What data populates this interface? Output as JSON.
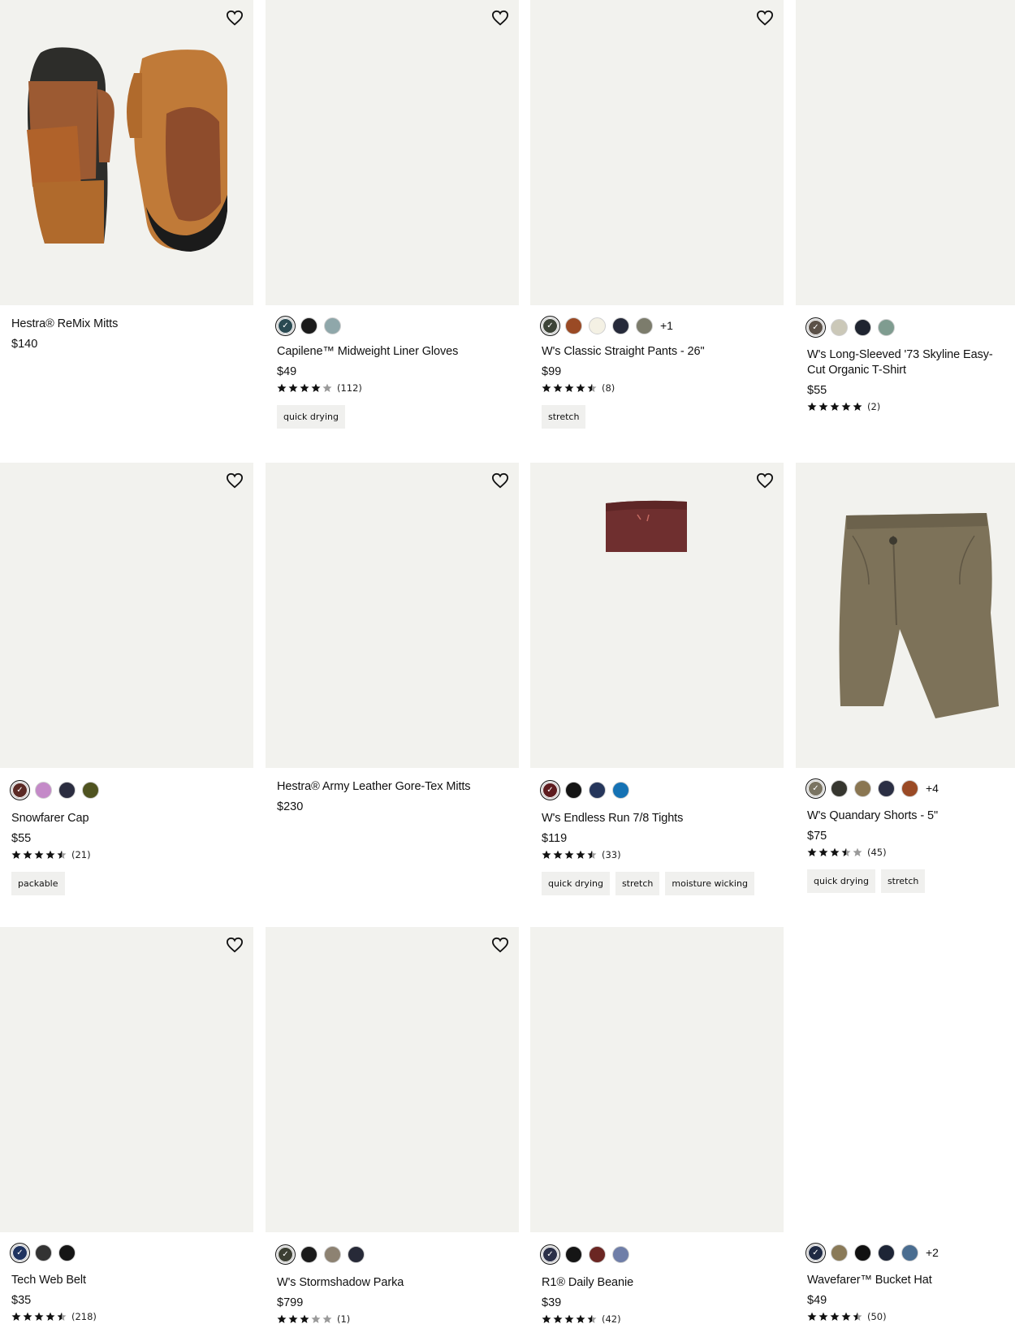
{
  "products": [
    {
      "name": "Hestra® ReMix Mitts",
      "price": "$140",
      "favorite_label": "Add to favorites"
    },
    {
      "name": "Capilene™ Midweight Liner Gloves",
      "price": "$49",
      "rating_count": "(112)",
      "rating": 4,
      "tags": [
        "quick drying"
      ],
      "swatches": [
        "#2a4a52",
        "#1b1b1b",
        "#8fa7aa"
      ]
    },
    {
      "name": "W's Classic Straight Pants - 26\"",
      "price": "$99",
      "rating_count": "(8)",
      "rating": 4.5,
      "tags": [
        "stretch"
      ],
      "swatches": [
        "#3d4438",
        "#9a4a25",
        "#f4f1e4",
        "#262a3a",
        "#7c7c6c"
      ],
      "more": "+1"
    },
    {
      "name": "W's Long-Sleeved '73 Skyline Easy-Cut Organic T-Shirt",
      "price": "$55",
      "rating_count": "(2)",
      "rating": 5,
      "swatches": [
        "#5b5148",
        "#cbc8b8",
        "#1f2430",
        "#7f9c90"
      ]
    },
    {
      "name": "Snowfarer Cap",
      "price": "$55",
      "rating_count": "(21)",
      "rating": 4.5,
      "tags": [
        "packable"
      ],
      "swatches": [
        "#5b2a25",
        "#c48ac8",
        "#2b2d40",
        "#4f5320"
      ]
    },
    {
      "name": "Hestra® Army Leather Gore-Tex Mitts",
      "price": "$230"
    },
    {
      "name": "W's Endless Run 7/8 Tights",
      "price": "$119",
      "rating_count": "(33)",
      "rating": 4.5,
      "tags": [
        "quick drying",
        "stretch",
        "moisture wicking"
      ],
      "swatches": [
        "#5e1c1f",
        "#141414",
        "#25365b",
        "#1572b4"
      ]
    },
    {
      "name": "W's Quandary Shorts - 5\"",
      "price": "$75",
      "rating_count": "(45)",
      "rating": 3.5,
      "tags": [
        "quick drying",
        "stretch"
      ],
      "swatches": [
        "#7a7462",
        "#36362f",
        "#8a7652",
        "#2b2f44",
        "#9a4a25"
      ],
      "more": "+4"
    },
    {
      "name": "Tech Web Belt",
      "price": "$35",
      "rating_count": "(218)",
      "rating": 4.5,
      "swatches": [
        "#1f3360",
        "#333333",
        "#151515"
      ]
    },
    {
      "name": "W's Stormshadow Parka",
      "price": "$799",
      "rating_count": "(1)",
      "rating": 3,
      "swatches": [
        "#3c3f33",
        "#1b1b1b",
        "#8d8272",
        "#272a38"
      ]
    },
    {
      "name": "R1® Daily Beanie",
      "price": "$39",
      "rating_count": "(42)",
      "rating": 4.5,
      "swatches": [
        "#2b3048",
        "#151515",
        "#6b2623",
        "#6f7ea8"
      ]
    },
    {
      "name": "Wavefarer™ Bucket Hat",
      "price": "$49",
      "rating_count": "(50)",
      "rating": 4.5,
      "swatches": [
        "#1f2a44",
        "#8a7a58",
        "#111111",
        "#1d2536",
        "#4a6d90"
      ],
      "more": "+2"
    }
  ]
}
